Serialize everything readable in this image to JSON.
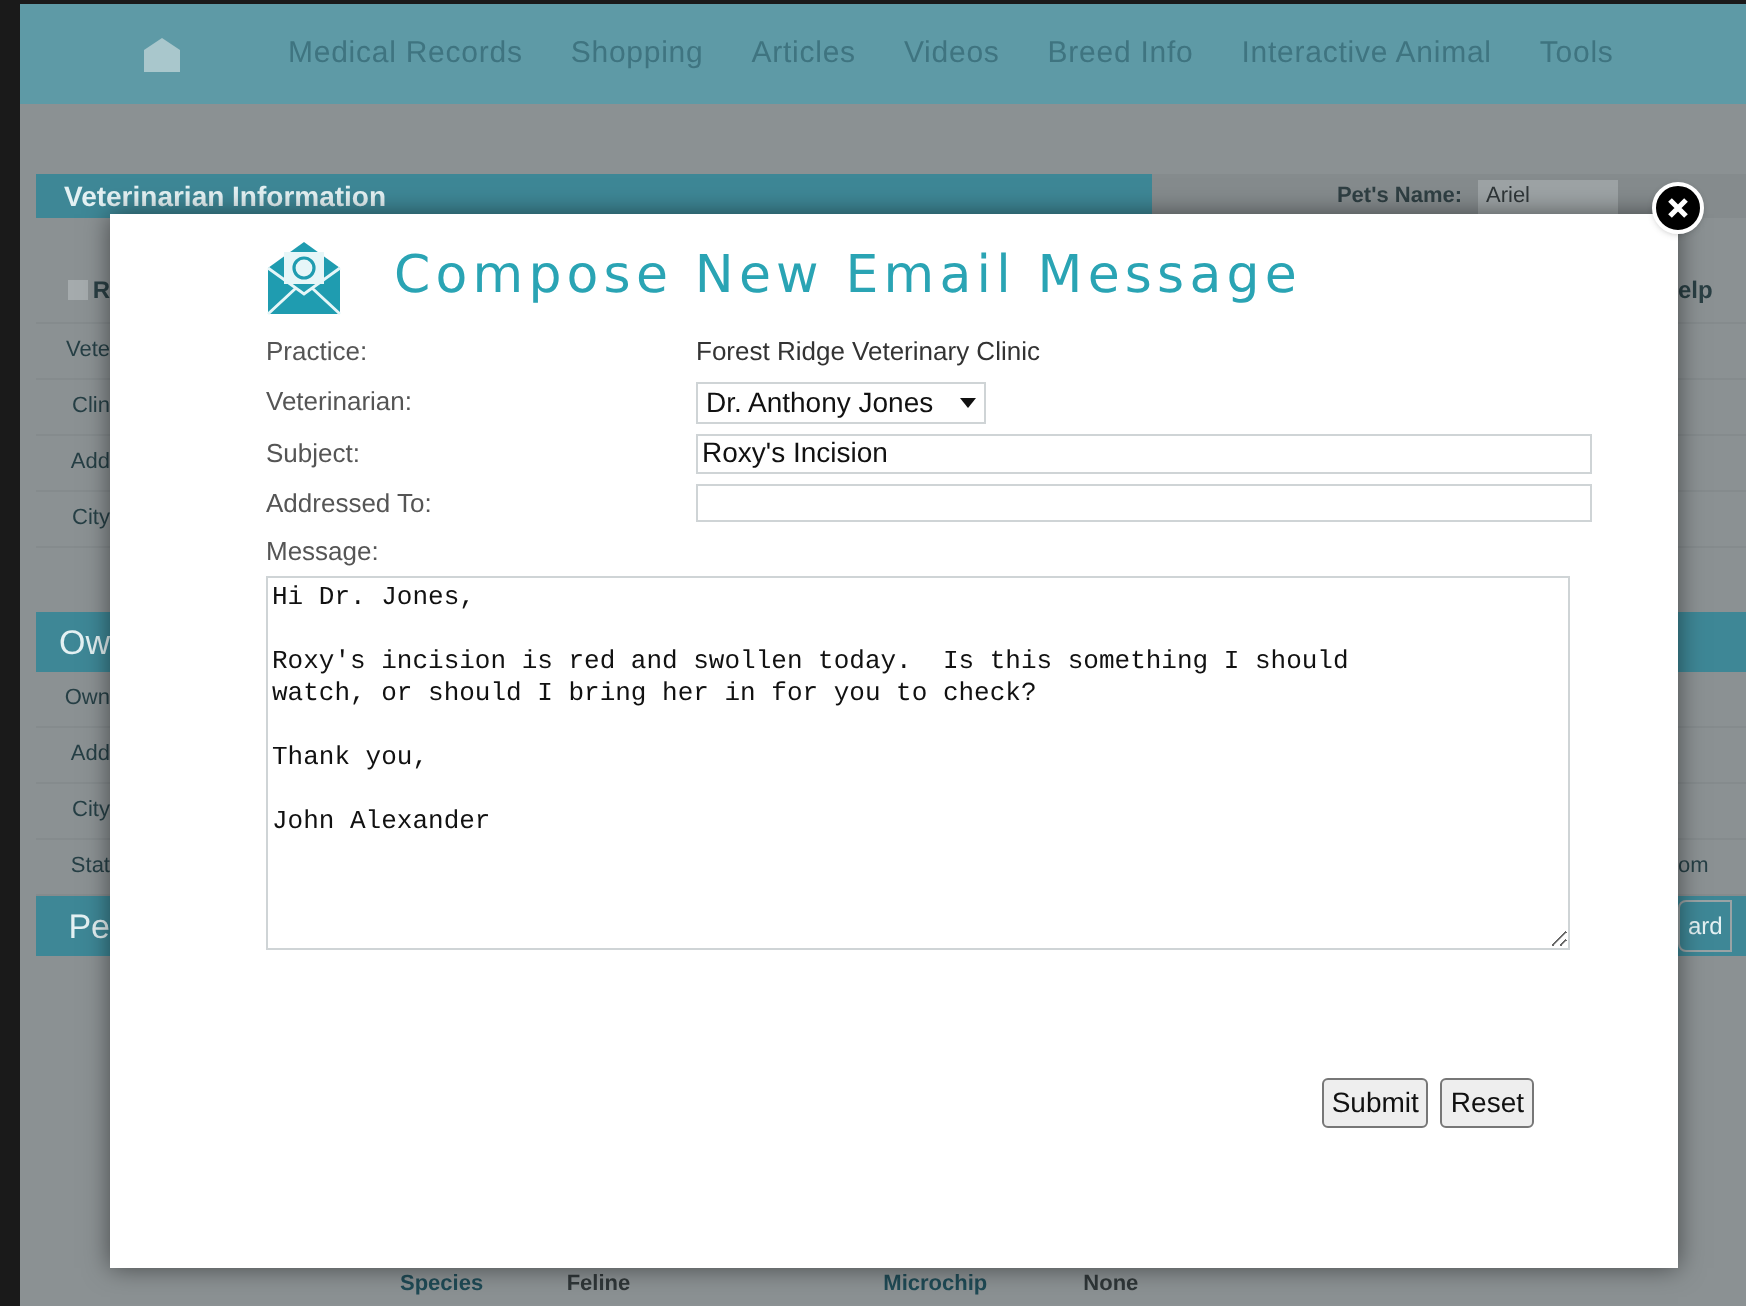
{
  "nav": {
    "items": [
      "Medical Records",
      "Shopping",
      "Articles",
      "Videos",
      "Breed Info",
      "Interactive Animal",
      "Tools"
    ]
  },
  "background": {
    "section_title": "Veterinarian Information",
    "pet_name_label": "Pet's Name:",
    "pet_name_value": "Ariel",
    "left_rows": [
      {
        "kind": "tab",
        "text": "R"
      },
      {
        "kind": "row",
        "text": "Vete"
      },
      {
        "kind": "row",
        "text": "Clin"
      },
      {
        "kind": "row",
        "text": "Add"
      },
      {
        "kind": "row",
        "text": "City"
      },
      {
        "kind": "spacer",
        "text": ""
      },
      {
        "kind": "header",
        "text": "Ow"
      },
      {
        "kind": "row",
        "text": "Own"
      },
      {
        "kind": "row",
        "text": "Add"
      },
      {
        "kind": "row",
        "text": "City"
      },
      {
        "kind": "row",
        "text": "Stat"
      },
      {
        "kind": "header",
        "text": "Pe"
      }
    ],
    "right_rows": [
      {
        "kind": "tab",
        "text": "elp"
      },
      {
        "kind": "row",
        "text": ""
      },
      {
        "kind": "row",
        "text": ""
      },
      {
        "kind": "row",
        "text": ""
      },
      {
        "kind": "row",
        "text": ""
      },
      {
        "kind": "spacer",
        "text": ""
      },
      {
        "kind": "header",
        "text": ""
      },
      {
        "kind": "row",
        "text": ""
      },
      {
        "kind": "row",
        "text": ""
      },
      {
        "kind": "row",
        "text": ""
      },
      {
        "kind": "row",
        "text": "om"
      },
      {
        "kind": "button",
        "text": "ard"
      }
    ],
    "bottom_row": [
      "Species",
      "Feline",
      "Microchip",
      "None"
    ]
  },
  "dialog": {
    "title": "Compose New Email Message",
    "practice_label": "Practice:",
    "practice": "Forest Ridge Veterinary Clinic",
    "veterinarian_label": "Veterinarian:",
    "veterinarian": "Dr. Anthony Jones",
    "subject_label": "Subject:",
    "subject": "Roxy's Incision",
    "addressed_to_label": "Addressed To:",
    "message_label": "Message:",
    "message": "Hi Dr. Jones,\n\nRoxy's incision is red and swollen today.  Is this something I should\nwatch, or should I bring her in for you to check?\n\nThank you,\n\nJohn Alexander",
    "buttons": [
      "Submit",
      "Reset"
    ]
  }
}
